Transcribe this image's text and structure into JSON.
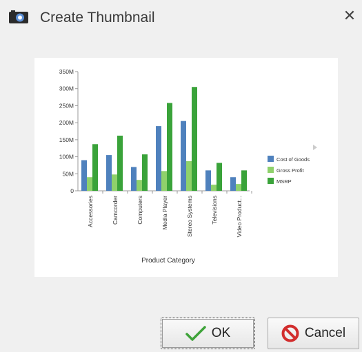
{
  "dialog": {
    "title": "Create Thumbnail",
    "close_glyph": "✕"
  },
  "buttons": {
    "ok_label": "OK",
    "cancel_label": "Cancel"
  },
  "icons": {
    "title": "camera-icon",
    "close": "close-icon",
    "ok": "checkmark-icon",
    "cancel": "prohibited-icon"
  },
  "colors": {
    "cost_of_goods": "#4f81bd",
    "gross_profit": "#8fd16b",
    "msrp": "#3aa33a"
  },
  "chart_data": {
    "type": "bar",
    "title": "",
    "xlabel": "Product Category",
    "ylabel": "",
    "ylim": [
      0,
      350000000
    ],
    "yticks": [
      "0",
      "50M",
      "100M",
      "150M",
      "200M",
      "250M",
      "300M",
      "350M"
    ],
    "categories": [
      "Accessories",
      "Camcorder",
      "Computers",
      "Media Player",
      "Stereo Systems",
      "Televisions",
      "Video Product..."
    ],
    "series": [
      {
        "name": "Cost of Goods",
        "color": "#4f81bd",
        "values": [
          90000000,
          105000000,
          70000000,
          190000000,
          205000000,
          60000000,
          40000000
        ]
      },
      {
        "name": "Gross Profit",
        "color": "#8fd16b",
        "values": [
          40000000,
          48000000,
          32000000,
          58000000,
          87000000,
          18000000,
          20000000
        ]
      },
      {
        "name": "MSRP",
        "color": "#3aa33a",
        "values": [
          137000000,
          162000000,
          107000000,
          258000000,
          305000000,
          82000000,
          60000000
        ]
      }
    ],
    "legend_position": "right",
    "grid": false
  }
}
